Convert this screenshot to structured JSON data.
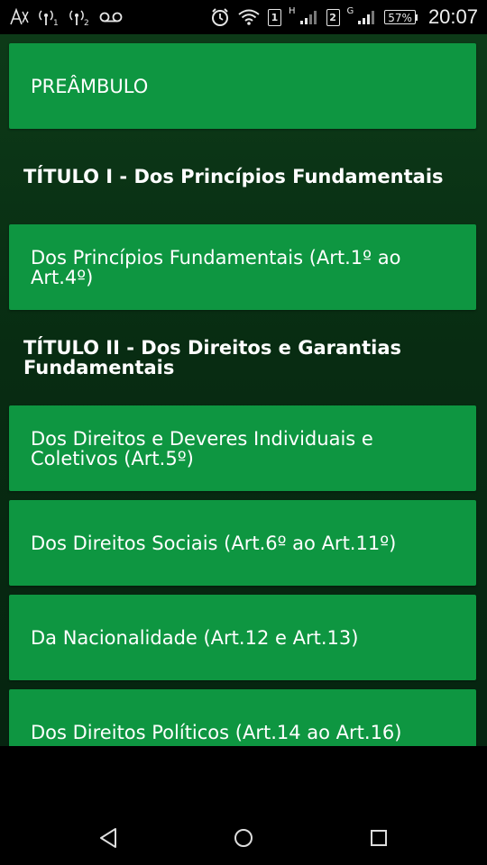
{
  "status_bar": {
    "sim1_label": "1",
    "sim1_network": "H",
    "sim2_label": "2",
    "sim2_network": "G",
    "battery": "57%",
    "time": "20:07"
  },
  "items": [
    {
      "type": "button",
      "label": "PREÂMBULO"
    },
    {
      "type": "heading",
      "label": "TÍTULO I - Dos Princípios Fundamentais"
    },
    {
      "type": "button",
      "label": "Dos Princípios Fundamentais (Art.1º ao Art.4º)"
    },
    {
      "type": "heading",
      "label": "TÍTULO II - Dos Direitos e Garantias Fundamentais"
    },
    {
      "type": "button",
      "label": "Dos Direitos e Deveres Individuais e Coletivos (Art.5º)"
    },
    {
      "type": "button",
      "label": "Dos Direitos Sociais (Art.6º ao Art.11º)"
    },
    {
      "type": "button",
      "label": "Da Nacionalidade (Art.12 e Art.13)"
    },
    {
      "type": "button",
      "label": "Dos Direitos Políticos (Art.14 ao Art.16)"
    }
  ]
}
